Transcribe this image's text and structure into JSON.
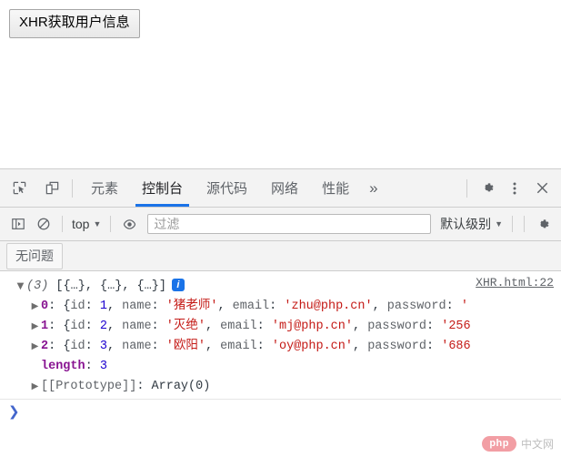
{
  "page": {
    "button_label": "XHR获取用户信息"
  },
  "devtools": {
    "toolbar_icons": {
      "inspect": "inspect-element-icon",
      "device": "device-toolbar-icon"
    },
    "tabs": [
      {
        "label": "元素",
        "active": false
      },
      {
        "label": "控制台",
        "active": true
      },
      {
        "label": "源代码",
        "active": false
      },
      {
        "label": "网络",
        "active": false
      },
      {
        "label": "性能",
        "active": false
      }
    ],
    "more_tabs_label": "»",
    "settings_label": "⚙",
    "menu_label": "⋮",
    "close_label": "✕"
  },
  "filterbar": {
    "sidebar_toggle": "console-sidebar-icon",
    "clear_console": "clear-console-icon",
    "context_value": "top",
    "eye_icon": "live-expression-icon",
    "filter_placeholder": "过滤",
    "filter_value": "",
    "level_value": "默认级别",
    "caret": "▼"
  },
  "issues": {
    "chip_label": "无问题"
  },
  "console": {
    "source_link": "XHR.html:22",
    "array_preview": {
      "triangle": "▼",
      "count": "(3)",
      "text": "[{…}, {…}, {…}]",
      "badge": "i"
    },
    "rows": [
      {
        "triangle": "▶",
        "index": "0",
        "open": "{",
        "fields": [
          {
            "key": "id",
            "sep": ": ",
            "value": "1",
            "type": "num"
          },
          {
            "key": "name",
            "sep": ": ",
            "value": "'猪老师'",
            "type": "str"
          },
          {
            "key": "email",
            "sep": ": ",
            "value": "'zhu@php.cn'",
            "type": "str"
          },
          {
            "key": "password",
            "sep": ": ",
            "value": "'",
            "type": "str"
          }
        ]
      },
      {
        "triangle": "▶",
        "index": "1",
        "open": "{",
        "fields": [
          {
            "key": "id",
            "sep": ": ",
            "value": "2",
            "type": "num"
          },
          {
            "key": "name",
            "sep": ": ",
            "value": "'灭绝'",
            "type": "str"
          },
          {
            "key": "email",
            "sep": ": ",
            "value": "'mj@php.cn'",
            "type": "str"
          },
          {
            "key": "password",
            "sep": ": ",
            "value": "'256",
            "type": "str"
          }
        ]
      },
      {
        "triangle": "▶",
        "index": "2",
        "open": "{",
        "fields": [
          {
            "key": "id",
            "sep": ": ",
            "value": "3",
            "type": "num"
          },
          {
            "key": "name",
            "sep": ": ",
            "value": "'欧阳'",
            "type": "str"
          },
          {
            "key": "email",
            "sep": ": ",
            "value": "'oy@php.cn'",
            "type": "str"
          },
          {
            "key": "password",
            "sep": ": ",
            "value": "'686",
            "type": "str"
          }
        ]
      }
    ],
    "length_row": {
      "key": "length",
      "sep": ": ",
      "value": "3"
    },
    "prototype_row": {
      "triangle": "▶",
      "key": "[[Prototype]]",
      "sep": ": ",
      "value": "Array(0)"
    },
    "prompt_symbol": "❯"
  },
  "watermark": {
    "badge": "php",
    "text": "中文网"
  },
  "colors": {
    "accent": "#1a73e8",
    "string": "#c41a16",
    "number": "#1c00cf",
    "key": "#881391",
    "toolbar_bg": "#f3f3f3"
  }
}
